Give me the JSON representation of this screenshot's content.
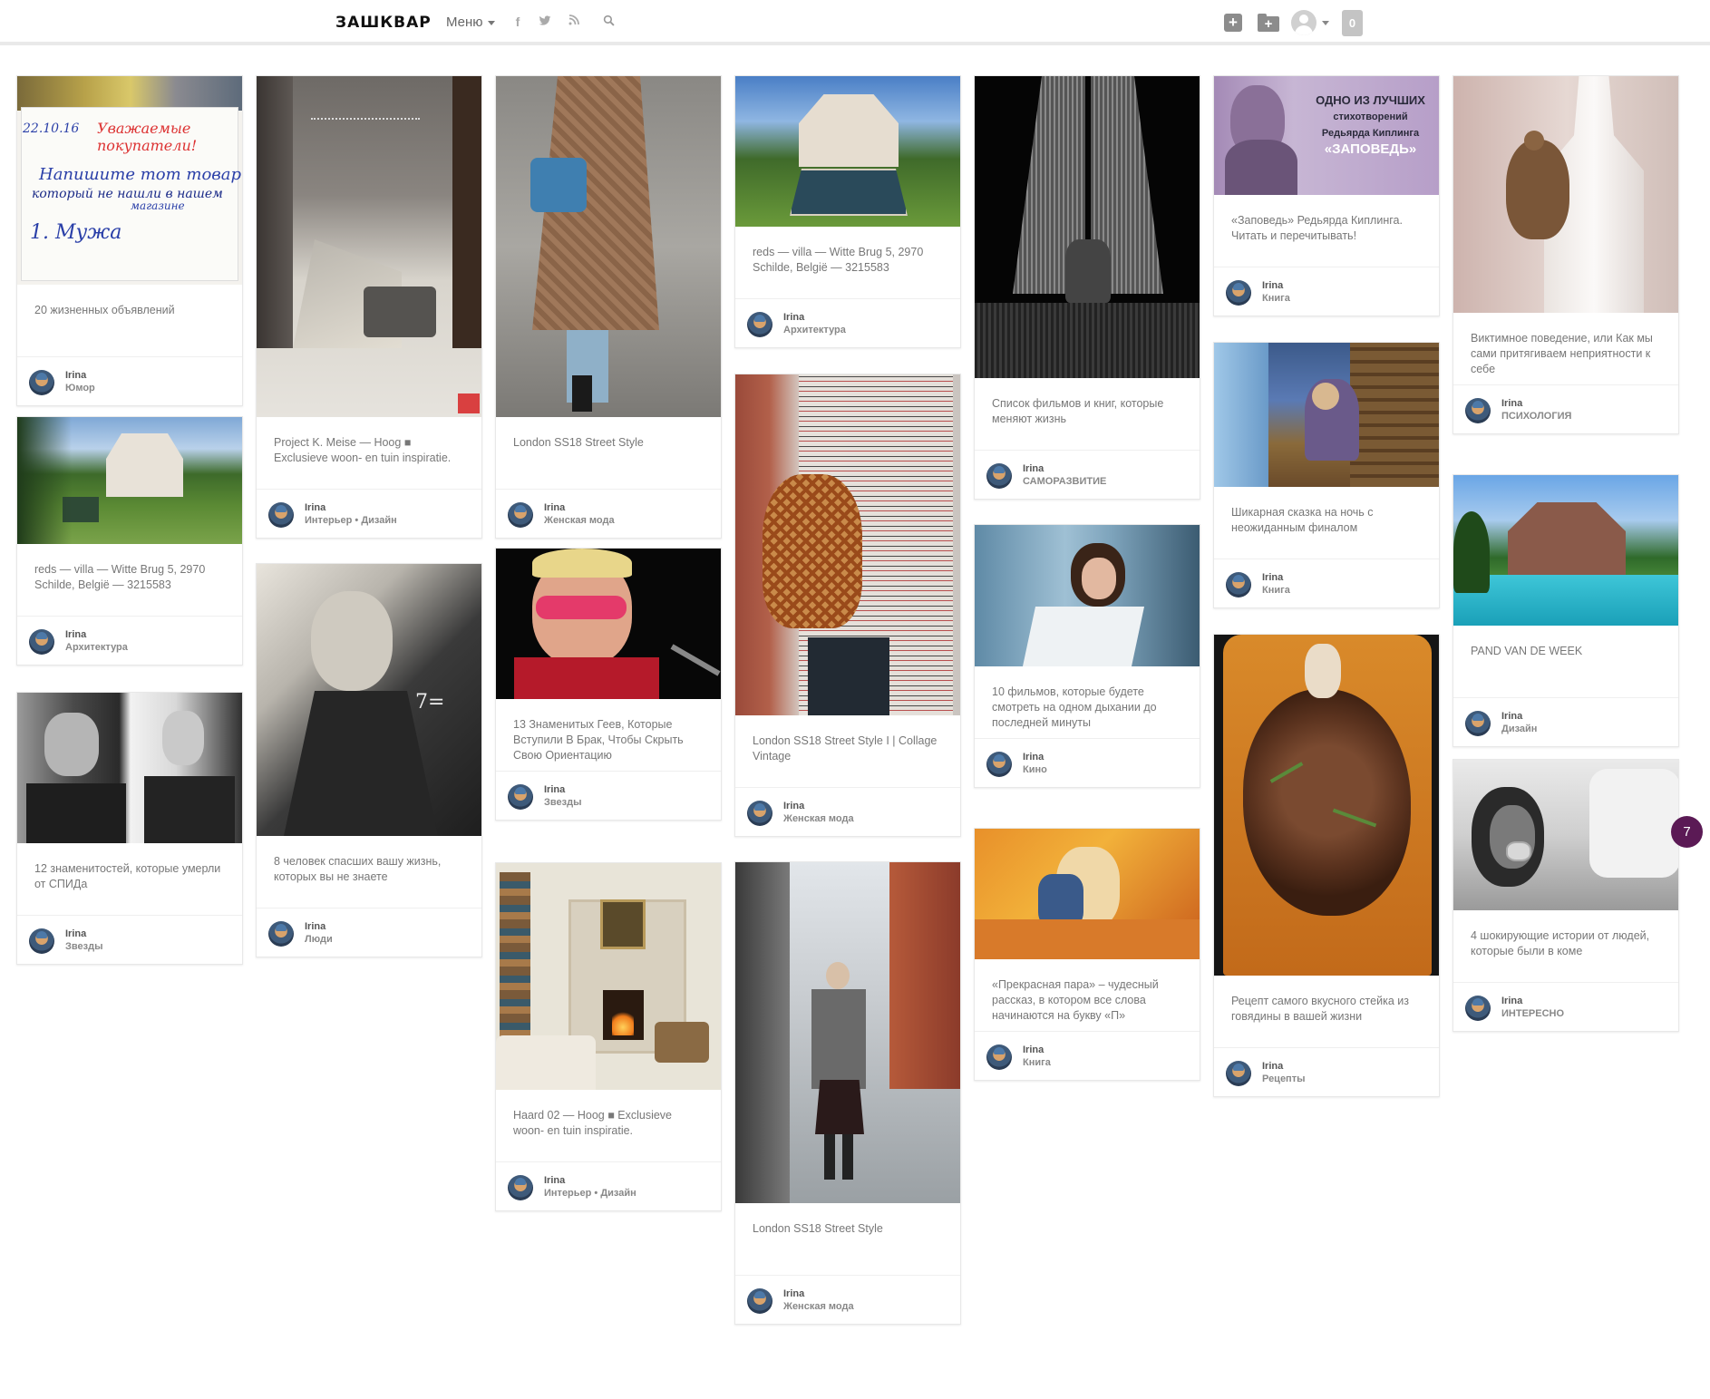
{
  "header": {
    "logo": "ЗАШКВАР",
    "menu_label": "Меню",
    "facebook_icon": "f",
    "twitter_icon": "twitter-icon",
    "rss_icon": "rss-icon",
    "search_icon": "search-icon",
    "add_button": "+",
    "add_folder_button": "+",
    "notifications_count": "0"
  },
  "columns": [
    [
      {
        "title": "20 жизненных объявлений",
        "author": "Irina",
        "category": "Юмор"
      },
      {
        "title": "reds — villa — Witte Brug 5, 2970 Schilde, België — 3215583",
        "author": "Irina",
        "category": "Архитектура"
      },
      {
        "title": "12 знаменитостей, которые умерли от СПИДа",
        "author": "Irina",
        "category": "Звезды"
      }
    ],
    [
      {
        "title": "Project K. Meise — Hoog ■ Exclusieve woon- en tuin inspiratie.",
        "author": "Irina",
        "category": "Интерьер • Дизайн"
      },
      {
        "title": "8 человек спасших вашу жизнь, которых вы не знаете",
        "author": "Irina",
        "category": "Люди"
      }
    ],
    [
      {
        "title": "London SS18 Street Style",
        "author": "Irina",
        "category": "Женская мода"
      },
      {
        "title": "13 Знаменитых Геев, Которые Вступили В Брак, Чтобы Скрыть Свою Ориентацию",
        "author": "Irina",
        "category": "Звезды"
      },
      {
        "title": "Haard 02 — Hoog ■ Exclusieve woon- en tuin inspiratie.",
        "author": "Irina",
        "category": "Интерьер • Дизайн"
      }
    ],
    [
      {
        "title": "reds — villa — Witte Brug 5, 2970 Schilde, België — 3215583",
        "author": "Irina",
        "category": "Архитектура"
      },
      {
        "title": "London SS18 Street Style I | Collage Vintage",
        "author": "Irina",
        "category": "Женская мода"
      },
      {
        "title": "London SS18 Street Style",
        "author": "Irina",
        "category": "Женская мода"
      }
    ],
    [
      {
        "title": "Список фильмов и книг, которые меняют жизнь",
        "author": "Irina",
        "category": "САМОРАЗВИТИЕ"
      },
      {
        "title": "10 фильмов, которые будете смотреть на одном дыхании до последней минуты",
        "author": "Irina",
        "category": "Кино"
      },
      {
        "title": "«Прекрасная пара» – чудесный рассказ, в котором все слова начинаются на букву «П»",
        "author": "Irina",
        "category": "Книга"
      }
    ],
    [
      {
        "title": "«Заповедь» Редьярда Киплинга. Читать и перечитывать!",
        "author": "Irina",
        "category": "Книга",
        "image_text": [
          "ОДНО ИЗ ЛУЧШИХ",
          "стихотворений",
          "Редьярда Киплинга",
          "«ЗАПОВЕДЬ»"
        ]
      },
      {
        "title": "Шикарная сказка на ночь с неожиданным финалом",
        "author": "Irina",
        "category": "Книга"
      },
      {
        "title": "Рецепт самого вкусного стейка из говядины в вашей жизни",
        "author": "Irina",
        "category": "Рецепты"
      }
    ],
    [
      {
        "title": "Виктимное поведение, или Как мы сами притягиваем неприятности к себе",
        "author": "Irina",
        "category": "ПСИХОЛОГИЯ"
      },
      {
        "title": "PAND VAN DE WEEK",
        "author": "Irina",
        "category": "Дизайн"
      },
      {
        "title": "4 шокирующие истории от людей, которые были в коме",
        "author": "Irina",
        "category": "ИНТЕРЕСНО"
      }
    ]
  ],
  "whiteboard_text": [
    "22.10.16",
    "Уважаемые покупатели!",
    "Напишите тот товар",
    "который не нашли в нашем",
    "магазине",
    "1. Мужа"
  ],
  "scroll_badge": "7",
  "colors": {
    "accent_badge": "#5b1a55",
    "header_border": "#e9e9e9"
  }
}
